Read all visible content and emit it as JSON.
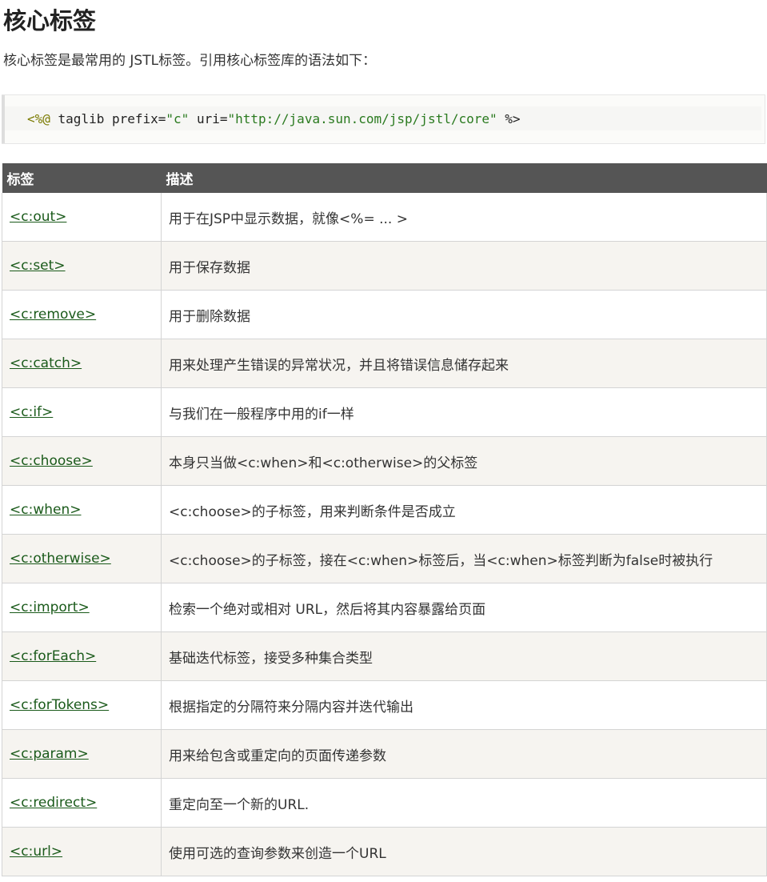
{
  "heading": "核心标签",
  "intro": "核心标签是最常用的 JSTL标签。引用核心标签库的语法如下：",
  "code": {
    "open": "<%@",
    "text1": " taglib prefix=",
    "prefix_value": "\"c\"",
    "text2": " uri=",
    "uri_value": "\"http://java.sun.com/jsp/jstl/core\"",
    "close": " %>"
  },
  "table": {
    "headers": [
      "标签",
      "描述"
    ],
    "rows": [
      {
        "tag": "<c:out>",
        "desc": "用于在JSP中显示数据，就像<%= ... >"
      },
      {
        "tag": "<c:set>",
        "desc": "用于保存数据"
      },
      {
        "tag": "<c:remove>",
        "desc": "用于删除数据"
      },
      {
        "tag": "<c:catch>",
        "desc": "用来处理产生错误的异常状况，并且将错误信息储存起来"
      },
      {
        "tag": "<c:if>",
        "desc": "与我们在一般程序中用的if一样"
      },
      {
        "tag": "<c:choose>",
        "desc": "本身只当做<c:when>和<c:otherwise>的父标签"
      },
      {
        "tag": "<c:when>",
        "desc": "<c:choose>的子标签，用来判断条件是否成立"
      },
      {
        "tag": "<c:otherwise>",
        "desc": "<c:choose>的子标签，接在<c:when>标签后，当<c:when>标签判断为false时被执行"
      },
      {
        "tag": "<c:import>",
        "desc": "检索一个绝对或相对 URL，然后将其内容暴露给页面"
      },
      {
        "tag": "<c:forEach>",
        "desc": "基础迭代标签，接受多种集合类型"
      },
      {
        "tag": "<c:forTokens>",
        "desc": "根据指定的分隔符来分隔内容并迭代输出"
      },
      {
        "tag": "<c:param>",
        "desc": "用来给包含或重定向的页面传递参数"
      },
      {
        "tag": "<c:redirect>",
        "desc": "重定向至一个新的URL."
      },
      {
        "tag": "<c:url>",
        "desc": "使用可选的查询参数来创造一个URL"
      }
    ]
  },
  "colors": {
    "header_bg": "#555555",
    "link": "#1a5a1a",
    "row_alt": "#f6f4f0"
  }
}
